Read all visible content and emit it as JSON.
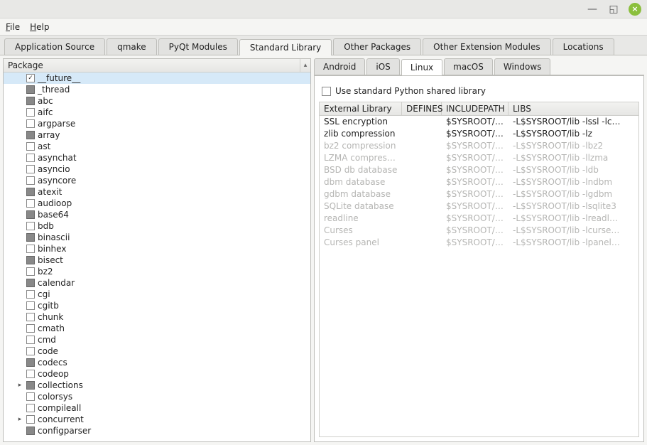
{
  "menubar": {
    "file": "File",
    "help": "Help"
  },
  "tabs": [
    {
      "label": "Application Source",
      "active": false
    },
    {
      "label": "qmake",
      "active": false
    },
    {
      "label": "PyQt Modules",
      "active": false
    },
    {
      "label": "Standard Library",
      "active": true
    },
    {
      "label": "Other Packages",
      "active": false
    },
    {
      "label": "Other Extension Modules",
      "active": false
    },
    {
      "label": "Locations",
      "active": false
    }
  ],
  "tree": {
    "header": "Package",
    "items": [
      {
        "label": "__future__",
        "state": "checked",
        "selected": true
      },
      {
        "label": "_thread",
        "state": "partial"
      },
      {
        "label": "abc",
        "state": "partial"
      },
      {
        "label": "aifc",
        "state": "unchecked"
      },
      {
        "label": "argparse",
        "state": "unchecked"
      },
      {
        "label": "array",
        "state": "partial"
      },
      {
        "label": "ast",
        "state": "unchecked"
      },
      {
        "label": "asynchat",
        "state": "unchecked"
      },
      {
        "label": "asyncio",
        "state": "unchecked"
      },
      {
        "label": "asyncore",
        "state": "unchecked"
      },
      {
        "label": "atexit",
        "state": "partial"
      },
      {
        "label": "audioop",
        "state": "unchecked"
      },
      {
        "label": "base64",
        "state": "partial"
      },
      {
        "label": "bdb",
        "state": "unchecked"
      },
      {
        "label": "binascii",
        "state": "partial"
      },
      {
        "label": "binhex",
        "state": "unchecked"
      },
      {
        "label": "bisect",
        "state": "partial"
      },
      {
        "label": "bz2",
        "state": "unchecked"
      },
      {
        "label": "calendar",
        "state": "partial"
      },
      {
        "label": "cgi",
        "state": "unchecked"
      },
      {
        "label": "cgitb",
        "state": "unchecked"
      },
      {
        "label": "chunk",
        "state": "unchecked"
      },
      {
        "label": "cmath",
        "state": "unchecked"
      },
      {
        "label": "cmd",
        "state": "unchecked"
      },
      {
        "label": "code",
        "state": "unchecked"
      },
      {
        "label": "codecs",
        "state": "partial"
      },
      {
        "label": "codeop",
        "state": "unchecked"
      },
      {
        "label": "collections",
        "state": "partial",
        "expandable": true
      },
      {
        "label": "colorsys",
        "state": "unchecked"
      },
      {
        "label": "compileall",
        "state": "unchecked"
      },
      {
        "label": "concurrent",
        "state": "unchecked",
        "expandable": true
      },
      {
        "label": "configparser",
        "state": "partial"
      }
    ]
  },
  "right": {
    "subtabs": [
      {
        "label": "Android",
        "active": false
      },
      {
        "label": "iOS",
        "active": false
      },
      {
        "label": "Linux",
        "active": true
      },
      {
        "label": "macOS",
        "active": false
      },
      {
        "label": "Windows",
        "active": false
      }
    ],
    "checkbox_label": "Use standard Python shared library",
    "table": {
      "headers": [
        "External Library",
        "DEFINES",
        "INCLUDEPATH",
        "LIBS"
      ],
      "rows": [
        {
          "enabled": true,
          "cells": [
            "SSL encryption",
            "",
            "$SYSROOT/i…",
            "-L$SYSROOT/lib -lssl -lc…"
          ]
        },
        {
          "enabled": true,
          "cells": [
            "zlib compression",
            "",
            "$SYSROOT/i…",
            "-L$SYSROOT/lib -lz"
          ]
        },
        {
          "enabled": false,
          "cells": [
            "bz2 compression",
            "",
            "$SYSROOT/i…",
            "-L$SYSROOT/lib -lbz2"
          ]
        },
        {
          "enabled": false,
          "cells": [
            "LZMA compression",
            "",
            "$SYSROOT/i…",
            "-L$SYSROOT/lib -llzma"
          ]
        },
        {
          "enabled": false,
          "cells": [
            "BSD db database",
            "",
            "$SYSROOT/i…",
            "-L$SYSROOT/lib -ldb"
          ]
        },
        {
          "enabled": false,
          "cells": [
            "dbm database",
            "",
            "$SYSROOT/i…",
            "-L$SYSROOT/lib -lndbm"
          ]
        },
        {
          "enabled": false,
          "cells": [
            "gdbm database",
            "",
            "$SYSROOT/i…",
            "-L$SYSROOT/lib -lgdbm"
          ]
        },
        {
          "enabled": false,
          "cells": [
            "SQLite database",
            "",
            "$SYSROOT/i…",
            "-L$SYSROOT/lib -lsqlite3"
          ]
        },
        {
          "enabled": false,
          "cells": [
            "readline",
            "",
            "$SYSROOT/i…",
            "-L$SYSROOT/lib -lreadl…"
          ]
        },
        {
          "enabled": false,
          "cells": [
            "Curses",
            "",
            "$SYSROOT/i…",
            "-L$SYSROOT/lib -lcurse…"
          ]
        },
        {
          "enabled": false,
          "cells": [
            "Curses panel",
            "",
            "$SYSROOT/i…",
            "-L$SYSROOT/lib -lpanel…"
          ]
        }
      ]
    }
  }
}
